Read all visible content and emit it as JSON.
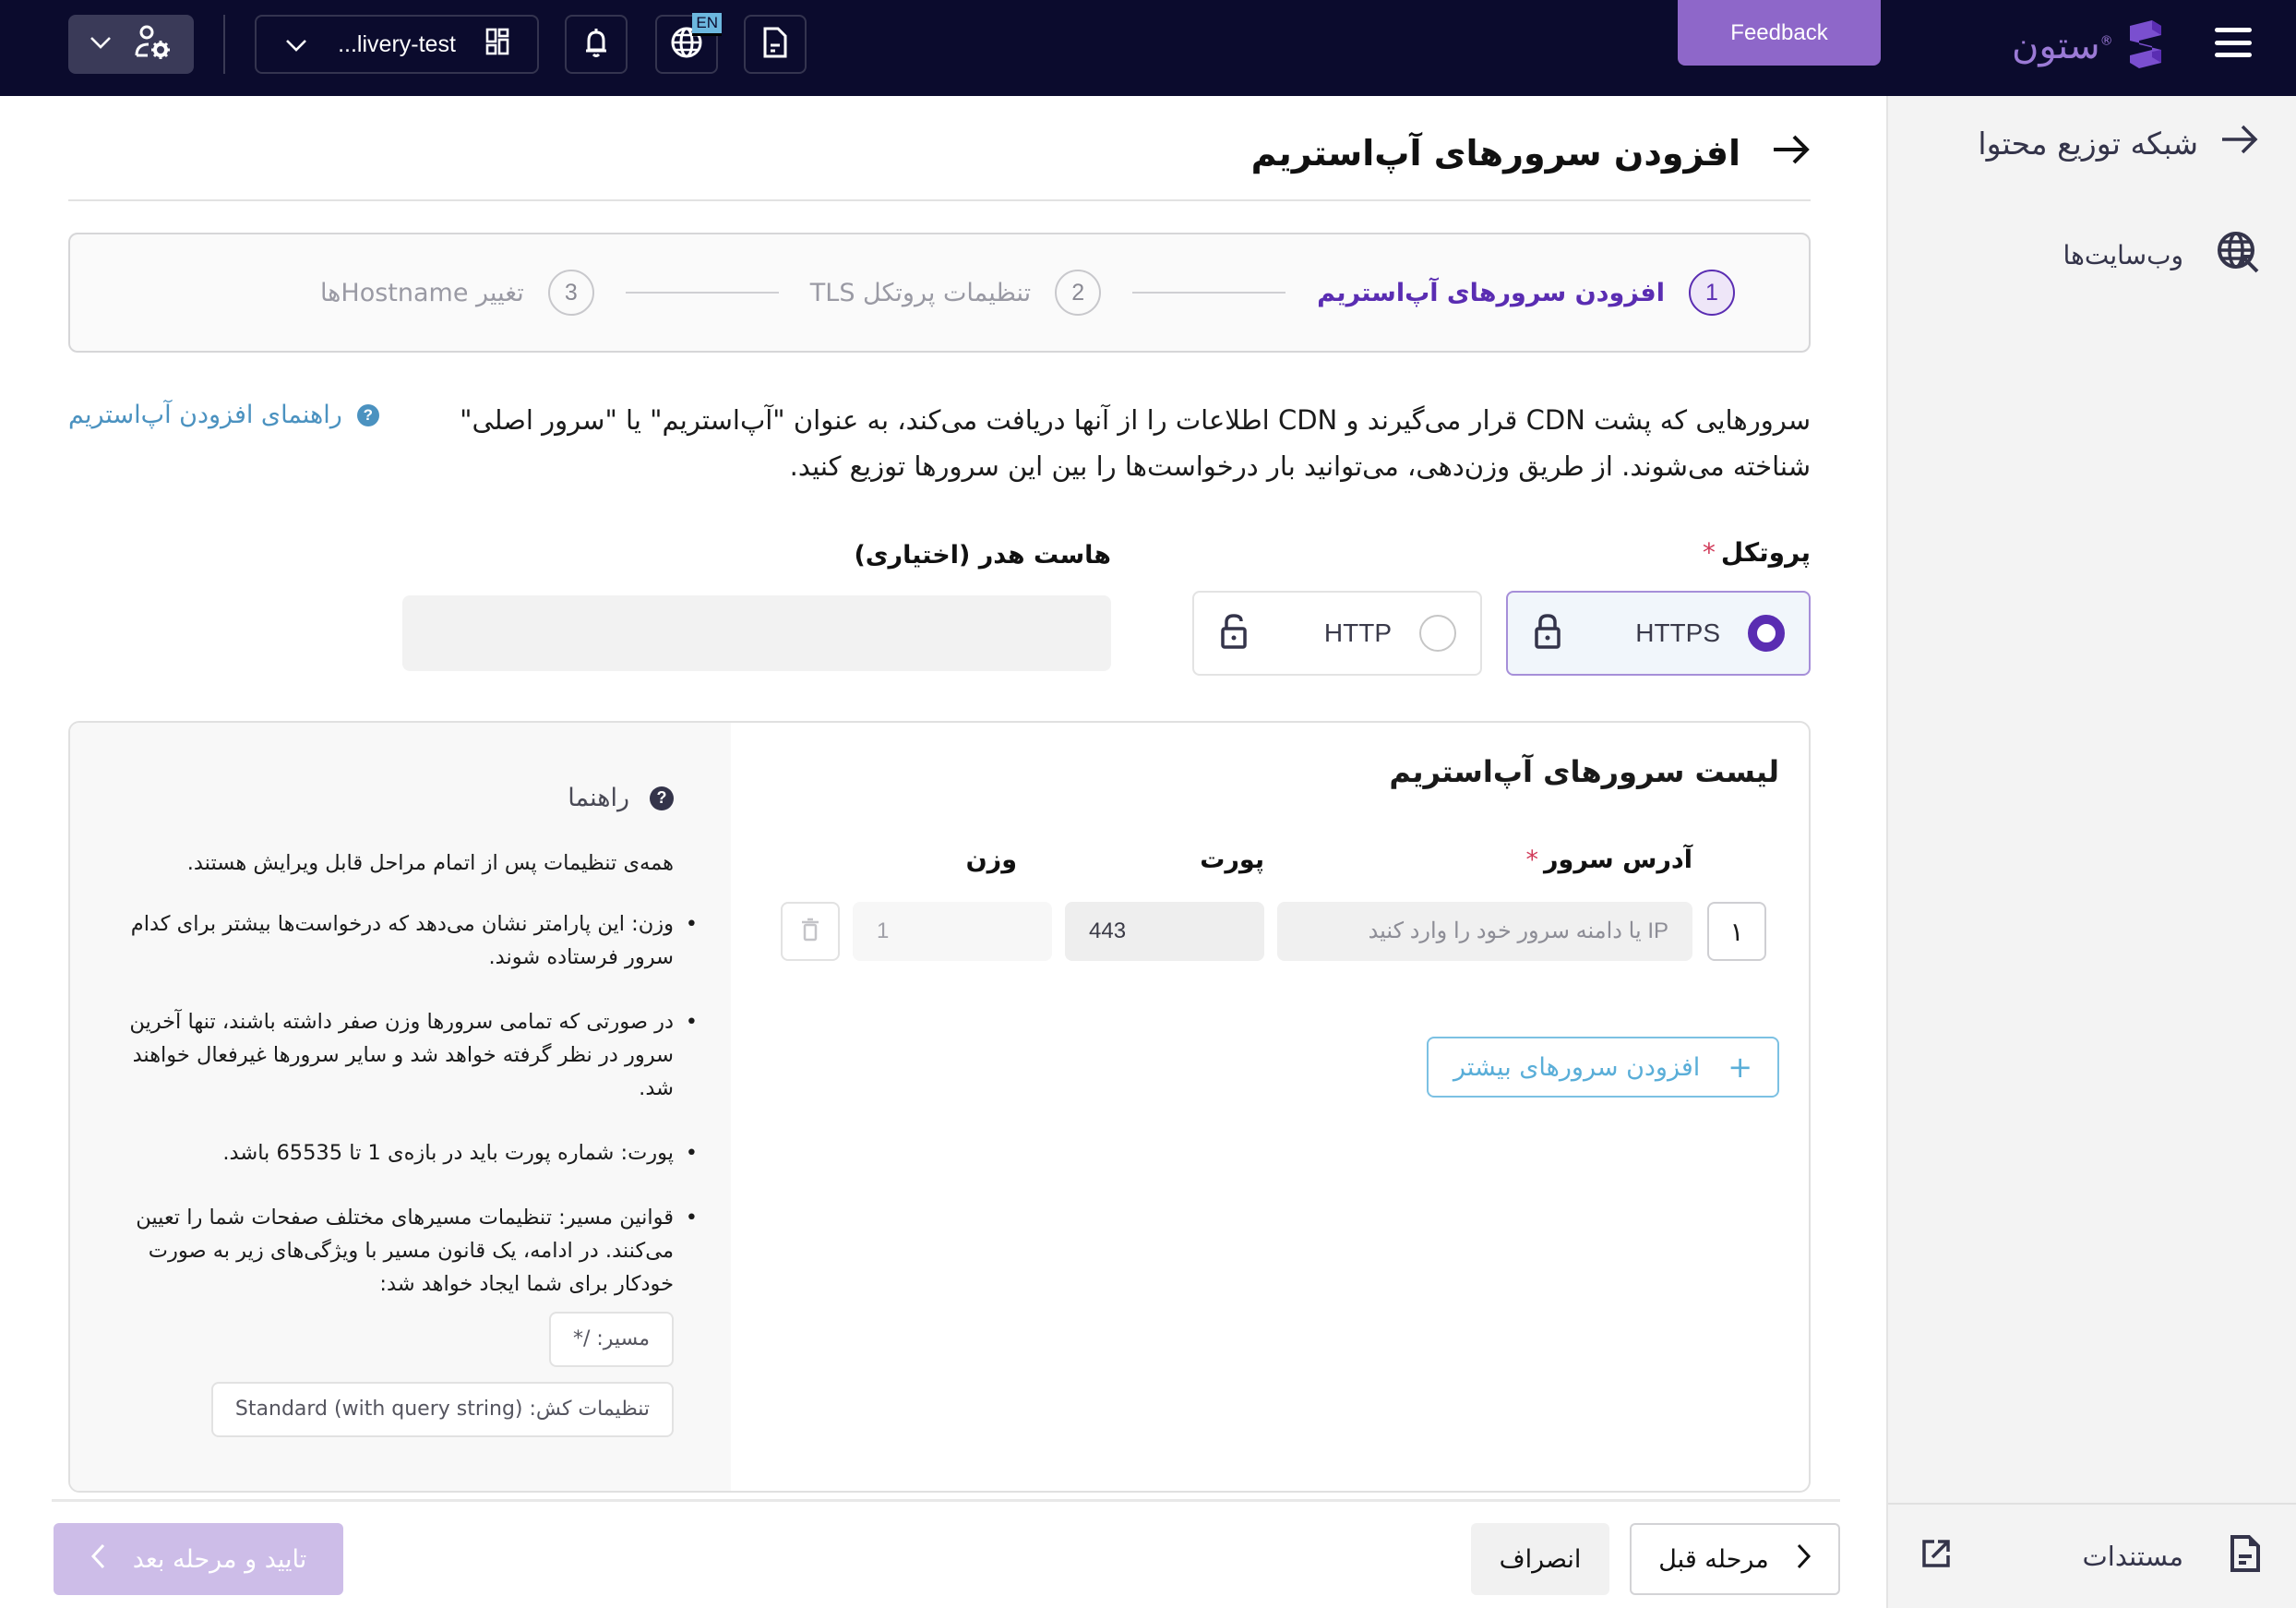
{
  "topbar": {
    "site_selector": "...livery-test",
    "language_badge": "EN",
    "feedback_label": "Feedback",
    "brand_name": "ستون",
    "brand_mark": "®",
    "icons": {
      "user_settings": "user-gear-icon",
      "site_selector_chevron": "chevron-down-icon",
      "site_grid": "grid-icon",
      "notifications": "bell-icon",
      "language": "globe-icon",
      "docs": "document-icon",
      "menu": "hamburger-icon"
    }
  },
  "sidebar": {
    "back_label": "شبکه توزیع محتوا",
    "items": [
      {
        "label": "وب‌سایت‌ها",
        "icon": "globe-cursor-icon"
      }
    ],
    "docs_label": "مستندات",
    "docs_icons": [
      "document-icon",
      "external-link-icon"
    ]
  },
  "page": {
    "title": "افزودن سرورهای آپ‌استریم",
    "steps": [
      {
        "number": "1",
        "label": "افزودن سرورهای آپ‌استریم",
        "active": true
      },
      {
        "number": "2",
        "label": "تنظیمات پروتکل TLS",
        "active": false
      },
      {
        "number": "3",
        "label": "تغییر Hostnameها",
        "active": false
      }
    ],
    "description": "سرورهایی که پشت CDN قرار می‌گیرند و CDN اطلاعات را از آنها دریافت می‌کند، به عنوان \"آپ‌استریم\" یا \"سرور اصلی\" شناخته می‌شوند. از طریق وزن‌دهی، می‌توانید بار درخواست‌ها را بین این سرورها توزیع کنید.",
    "guide_link": "راهنمای افزودن آپ‌استریم"
  },
  "protocol": {
    "label": "پروتکل",
    "required_mark": "*",
    "options": [
      {
        "label": "HTTPS",
        "selected": true,
        "icon": "lock-closed-icon"
      },
      {
        "label": "HTTP",
        "selected": false,
        "icon": "lock-open-icon"
      }
    ]
  },
  "host_header": {
    "label": "هاست هدر (اختیاری)",
    "value": "",
    "placeholder": ""
  },
  "upstream_list": {
    "title": "لیست سرورهای آپ‌استریم",
    "columns": {
      "address": "آدرس سرور",
      "port": "پورت",
      "weight": "وزن"
    },
    "required_mark": "*",
    "rows": [
      {
        "index": "۱",
        "address": "",
        "address_placeholder": "IP یا دامنه سرور خود را وارد کنید",
        "port": "443",
        "weight": "1"
      }
    ],
    "add_more_label": "افزودن سرورهای بیشتر",
    "add_icon": "+"
  },
  "help": {
    "title": "راهنما",
    "intro": "همه‌ی تنظیمات پس از اتمام مراحل قابل ویرایش هستند.",
    "bullets": [
      "وزن: این پارامتر نشان می‌دهد که درخواست‌ها بیشتر برای کدام سرور فرستاده شوند.",
      "در صورتی که تمامی سرورها وزن صفر داشته باشند، تنها آخرین سرور در نظر گرفته خواهد شد و سایر سرورها غیرفعال خواهند شد.",
      "پورت: شماره پورت باید در بازه‌ی 1 تا 65535 باشد.",
      "قوانین مسیر: تنظیمات مسیرهای مختلف صفحات شما را تعیین می‌کنند. در ادامه، یک قانون مسیر با ویژگی‌های زیر به صورت خودکار برای شما ایجاد خواهد شد:"
    ],
    "chips": [
      "مسیر: /*",
      "تنظیمات کش: Standard (with query string)"
    ]
  },
  "footer": {
    "prev_label": "مرحله قبل",
    "cancel_label": "انصراف",
    "next_label": "تایید و مرحله بعد"
  },
  "colors": {
    "topbar_bg": "#0b0b2d",
    "accent_purple": "#5a2db2",
    "feedback_bg": "#8e67c9",
    "link_blue": "#4b92c0",
    "required_red": "#d13b5a",
    "next_disabled": "#cdbde8"
  }
}
